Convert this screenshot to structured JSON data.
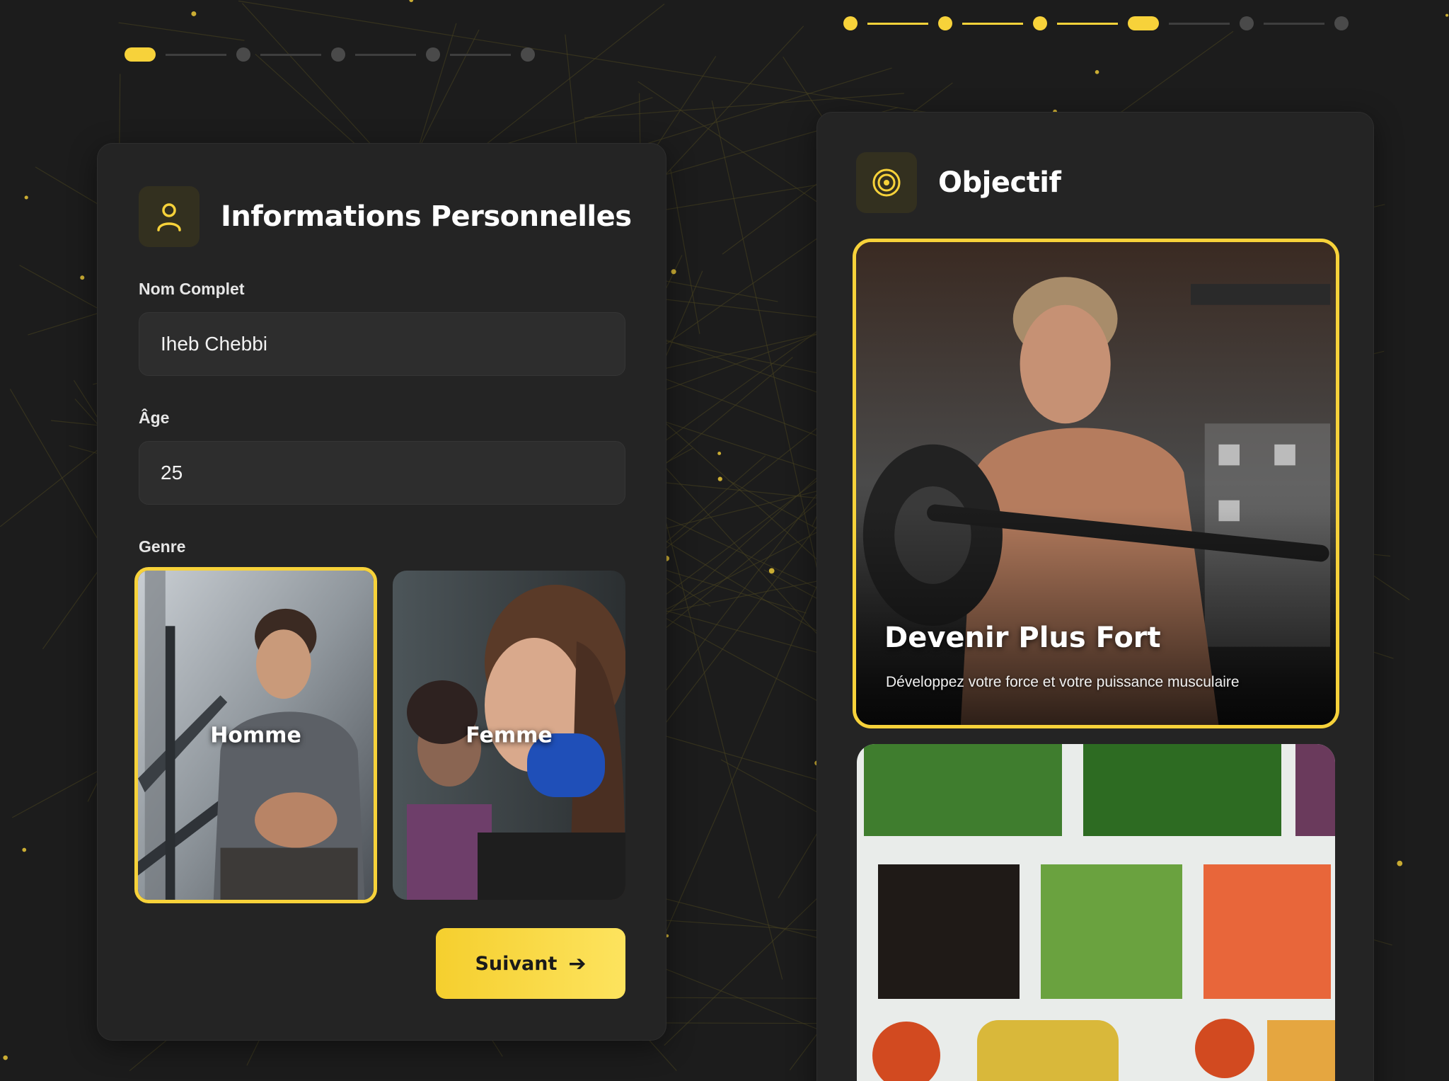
{
  "colors": {
    "accent": "#f7d23a",
    "background": "#1c1c1c",
    "card": "#242424",
    "input": "#2d2d2d"
  },
  "left_step": {
    "stepper": {
      "total": 5,
      "current": 1
    },
    "icon": "user-icon",
    "title": "Informations Personnelles",
    "name_label": "Nom Complet",
    "name_value": "Iheb Chebbi",
    "age_label": "Âge",
    "age_value": "25",
    "gender_label": "Genre",
    "gender_options": [
      {
        "label": "Homme",
        "selected": true
      },
      {
        "label": "Femme",
        "selected": false
      }
    ],
    "next_label": "Suivant",
    "next_icon": "arrow-right-icon"
  },
  "right_step": {
    "stepper": {
      "total": 6,
      "current": 4
    },
    "icon": "target-icon",
    "title": "Objectif",
    "goals": [
      {
        "title": "Devenir Plus Fort",
        "description": "Développez votre force et votre puissance musculaire",
        "selected": true
      }
    ]
  }
}
